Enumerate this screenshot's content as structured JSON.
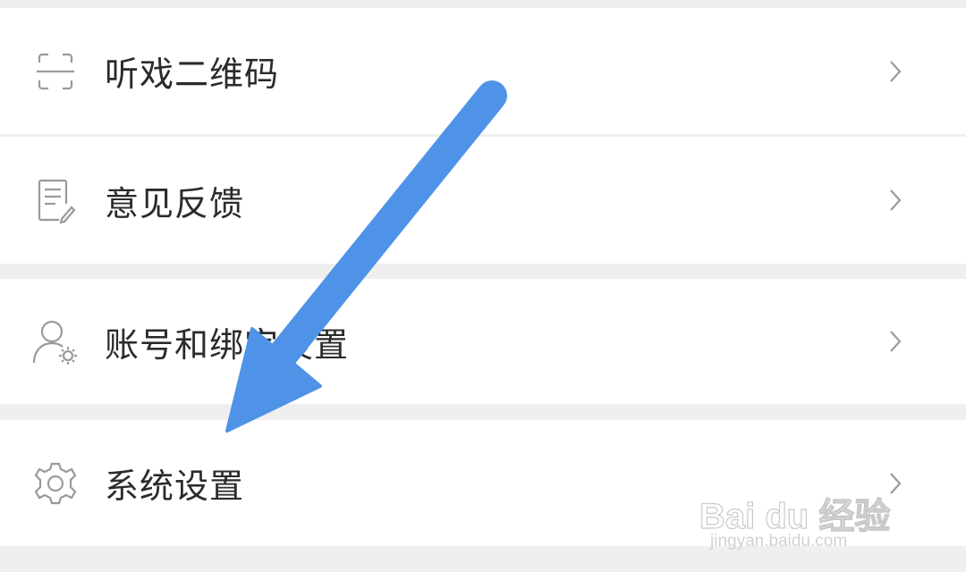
{
  "menu": {
    "items": [
      {
        "label": "听戏二维码",
        "icon": "qr-scan-icon"
      },
      {
        "label": "意见反馈",
        "icon": "feedback-note-icon"
      },
      {
        "label": "账号和绑定设置",
        "icon": "user-settings-icon"
      },
      {
        "label": "系统设置",
        "icon": "gear-icon"
      }
    ],
    "chevron_icon": "chevron-right-icon"
  },
  "annotation": {
    "arrow_color": "#4f93e8",
    "points_to": "系统设置"
  },
  "watermark": {
    "brand": "Bai du 经验",
    "url": "jingyan.baidu.com"
  }
}
